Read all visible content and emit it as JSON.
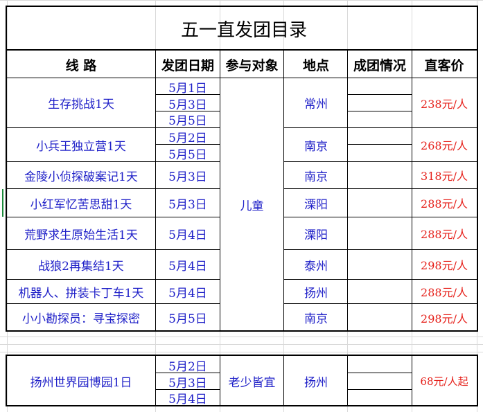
{
  "title": "五一直发团目录",
  "headers": {
    "route": "线  路",
    "date": "发团日期",
    "audience": "参与对象",
    "location": "地点",
    "status": "成团情况",
    "price": "直客价"
  },
  "rows": [
    {
      "route": "生存挑战1天",
      "dates": [
        "5月1日",
        "5月3日",
        "5月5日"
      ],
      "location": "常州",
      "price": "238元/人"
    },
    {
      "route": "小兵王独立营1天",
      "dates": [
        "5月2日",
        "5月5日"
      ],
      "location": "南京",
      "price": "268元/人"
    },
    {
      "route": "金陵小侦探破案记1天",
      "dates": [
        "5月3日"
      ],
      "location": "南京",
      "price": "318元/人"
    },
    {
      "route": "小红军忆苦思甜1天",
      "dates": [
        "5月3日"
      ],
      "location": "溧阳",
      "price": "288元/人"
    },
    {
      "route": "荒野求生原始生活1天",
      "dates": [
        "5月4日"
      ],
      "location": "溧阳",
      "price": "288元/人"
    },
    {
      "route": "战狼2再集结1天",
      "dates": [
        "5月4日"
      ],
      "location": "泰州",
      "price": "298元/人"
    },
    {
      "route": "机器人、拼装卡丁车1天",
      "dates": [
        "5月4日"
      ],
      "location": "扬州",
      "price": "288元/人"
    },
    {
      "route": "小小勘探员：寻宝探密",
      "dates": [
        "5月5日"
      ],
      "location": "南京",
      "price": "298元/人"
    }
  ],
  "audience_children": "儿童",
  "extra": {
    "route": "扬州世界园博园1日",
    "dates": [
      "5月2日",
      "5月3日",
      "5月4日"
    ],
    "audience": "老少皆宜",
    "location": "扬州",
    "price": "68元/人起"
  }
}
